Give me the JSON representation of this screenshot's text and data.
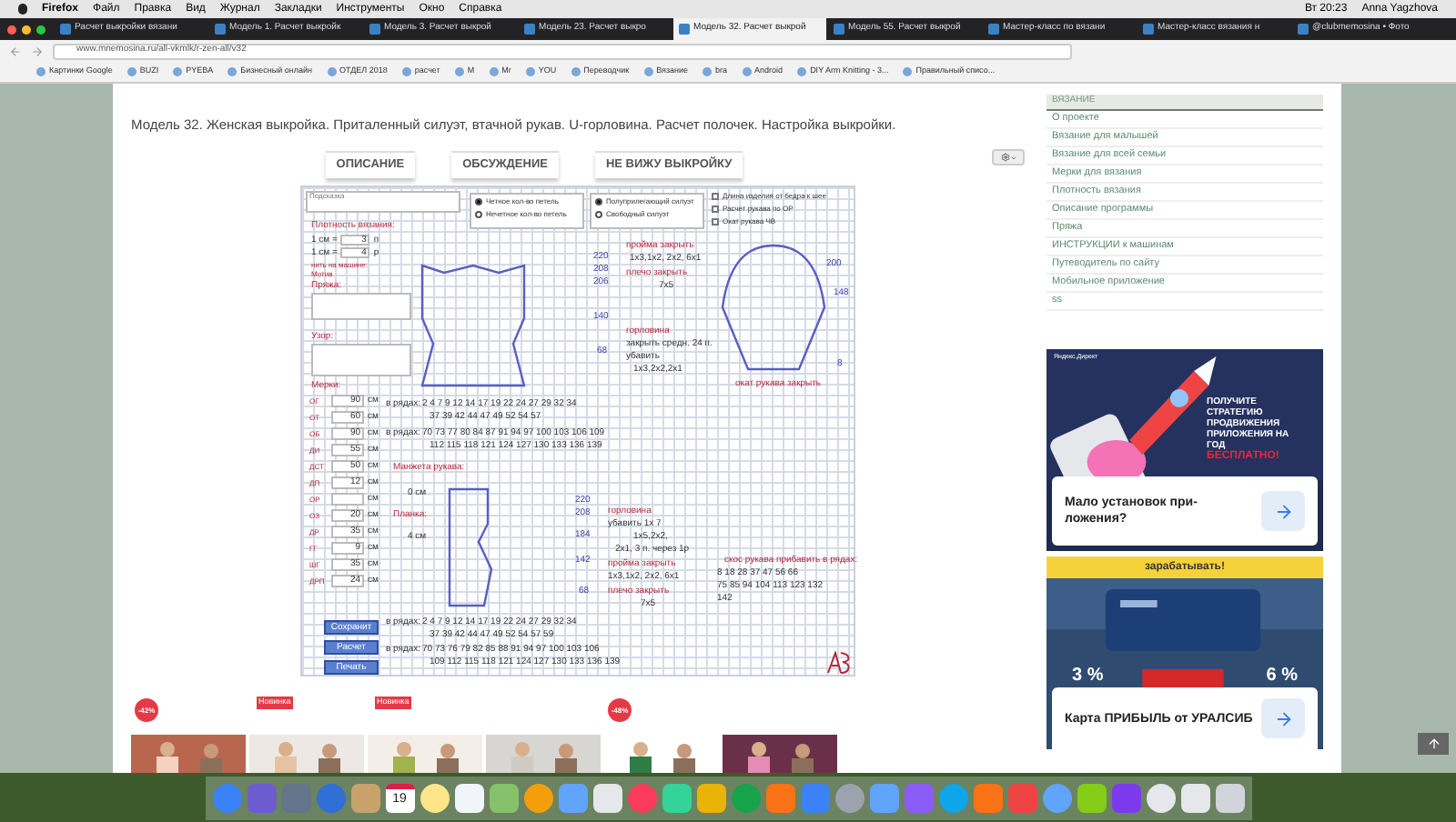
{
  "menubar": {
    "app": "Firefox",
    "items": [
      "Файл",
      "Правка",
      "Вид",
      "Журнал",
      "Закладки",
      "Инструменты",
      "Окно",
      "Справка"
    ],
    "clock": "Вт 20:23",
    "user": "Anna Yagzhova"
  },
  "tabs": [
    {
      "label": "Расчет выкройки вязани",
      "selected": false
    },
    {
      "label": "Модель 1. Расчет выкройк",
      "selected": false
    },
    {
      "label": "Модель 3. Расчет выкрой",
      "selected": false
    },
    {
      "label": "Модель 23. Расчет выкро",
      "selected": false
    },
    {
      "label": "Модель 32. Расчет выкрой",
      "selected": true
    },
    {
      "label": "Модель 55. Расчет выкрой",
      "selected": false
    },
    {
      "label": "Мастер-класс по вязани",
      "selected": false
    },
    {
      "label": "Мастер-класс вязания н",
      "selected": false
    },
    {
      "label": "@clubmemosina • Фото",
      "selected": false
    }
  ],
  "url": "www.mnemosina.ru/all-vkmlk/r-zen-all/v32",
  "bookmarks": [
    "Картинки Google",
    "BUZI",
    "PYEBA",
    "Бизнесный онлайн",
    "ОТДЕЛ 2018",
    "расчет",
    "M",
    "Mr",
    "YOU",
    "Переводчик",
    "Вязание",
    "bra",
    "Android",
    "DIY Arm Knitting - 3...",
    "Правильный списо..."
  ],
  "page": {
    "title": "Модель 32. Женская выкройка. Приталенный силуэт, втачной рукав. U-горловина. Расчет полочек. Настройка выкройки.",
    "tabs": [
      {
        "label": "ОПИСАНИЕ"
      },
      {
        "label": "ОБСУЖДЕНИЕ"
      },
      {
        "label": "НЕ ВИЖУ ВЫКРОЙКУ"
      }
    ],
    "worksheet": {
      "hint_label": "Подсказка",
      "radio_groups": [
        [
          {
            "label": "Четное кол-во петель",
            "selected": true
          },
          {
            "label": "Нечетное кол-во петель",
            "selected": false
          }
        ],
        [
          {
            "label": "Полуприлегающий силуэт",
            "selected": true
          },
          {
            "label": "Свободный силуэт",
            "selected": false
          }
        ]
      ],
      "checkboxes": [
        {
          "label": "Длина изделия от бедра к шее",
          "checked": false
        },
        {
          "label": "Расчет рукава по ОР",
          "checked": false
        },
        {
          "label": "Окат рукава ЧВ",
          "checked": false
        }
      ],
      "density": {
        "title": "Плотность вязания:",
        "rows": [
          {
            "label": "1 см =",
            "value": "3",
            "unit": "п"
          },
          {
            "label": "1 см =",
            "value": "4",
            "unit": "р"
          }
        ],
        "machine_label": "нить на машине:",
        "motif_label": "Мотив"
      },
      "yarn_label": "Пряжа:",
      "pattern_label": "Узор:",
      "measurements": {
        "title": "Мерки:",
        "items": [
          {
            "label": "ОГ",
            "value": "90",
            "unit": "см"
          },
          {
            "label": "ОТ",
            "value": "60",
            "unit": "см"
          },
          {
            "label": "ОБ",
            "value": "90",
            "unit": "см"
          },
          {
            "label": "ДИ",
            "value": "55",
            "unit": "см"
          },
          {
            "label": "ДСТ",
            "value": "50",
            "unit": "см"
          },
          {
            "label": "ДП",
            "value": "12",
            "unit": "см"
          },
          {
            "label": "ОР",
            "value": "",
            "unit": "см"
          },
          {
            "label": "ОЗ",
            "value": "20",
            "unit": "см"
          },
          {
            "label": "ДР",
            "value": "35",
            "unit": "см"
          },
          {
            "label": "ГГ",
            "value": "9",
            "unit": "см"
          },
          {
            "label": "ШГ",
            "value": "35",
            "unit": "см"
          },
          {
            "label": "ДРП",
            "value": "24",
            "unit": "см"
          }
        ]
      },
      "notes": [
        "пройма закрыть",
        "1х3,1х2, 2х2, 6х1",
        "плечо закрыть",
        "7х5",
        "горловина",
        "закрыть средн. 24 п.",
        "убавить",
        "1х3,2х2,2х1",
        "окат рукава закрыть",
        "Манжета рукава:",
        "0 см",
        "Планка:",
        "4 см",
        "горловина",
        "убавить 1х 7",
        "1х5,2х2,",
        "2х1, 3 п. через 1р",
        "пройма закрыть",
        "1х3,1х2, 2х2, 6х1",
        "плечо закрыть",
        "7х5",
        "скос рукава прибавить в рядах:",
        "8 18 28 37 47 56 66",
        "75 85 94 104 113 123 132",
        "142",
        "в рядах:",
        "2 4 7 9 12 14 17 19 22 24 27 29 32 34",
        "37 39 42 44 47 49 52 54 57",
        "в рядах:",
        "70 73 77 80 84 87 91 94 97 100 103 106 109",
        "112 115 118 121 124 127 130 133 136 139",
        "в рядах:",
        "2 4 7 9 12 14 17 19 22 24 27 29 32 34",
        "37 39 42 44 47 49 52 54 57 59",
        "в рядах:",
        "70 73 76 79 82 85 88 91 94 97 100 103 106",
        "109 112 115 118 121 124 127 130 133 136 139",
        "220",
        "208",
        "206",
        "140",
        "68",
        "200",
        "148",
        "8",
        "220",
        "208",
        "184",
        "142",
        "68"
      ],
      "buttons": [
        "Сохранит",
        "Расчет",
        "Печать"
      ]
    },
    "sidebar": {
      "heading": "ВЯЗАНИЕ",
      "items": [
        "О проекте",
        "Вязание для малышей",
        "Вязание для всей семьи",
        "Мерки для вязания",
        "Плотность вязания",
        "Описание программы",
        "Пряжа",
        "ИНСТРУКЦИИ к машинам",
        "Путеводитель по сайту",
        "Мобильное приложение",
        "ss"
      ]
    },
    "ads": [
      {
        "source": "Яндекс.Директ",
        "headline": "ПОЛУЧИТЕ СТРАТЕГИЮ ПРОДВИЖЕНИЯ ПРИЛОЖЕНИЯ НА ГОД",
        "accent": "БЕСПЛАТНО!",
        "card": "Мало установок при-ложения?"
      },
      {
        "headline": "зарабатывать!",
        "left_rate": "3 %",
        "right_rate": "6 %",
        "card": "Карта ПРИБЫЛЬ от УРАЛСИБ"
      }
    ],
    "products": [
      {
        "badge": "-42%",
        "kind": "sale"
      },
      {
        "badge": "Новинка",
        "kind": "new"
      },
      {
        "badge": "Новинка",
        "kind": "new"
      },
      {
        "kind": "none"
      },
      {
        "badge": "-48%",
        "kind": "sale"
      },
      {
        "kind": "none"
      }
    ]
  },
  "dock": {
    "calendar_day": "19"
  }
}
